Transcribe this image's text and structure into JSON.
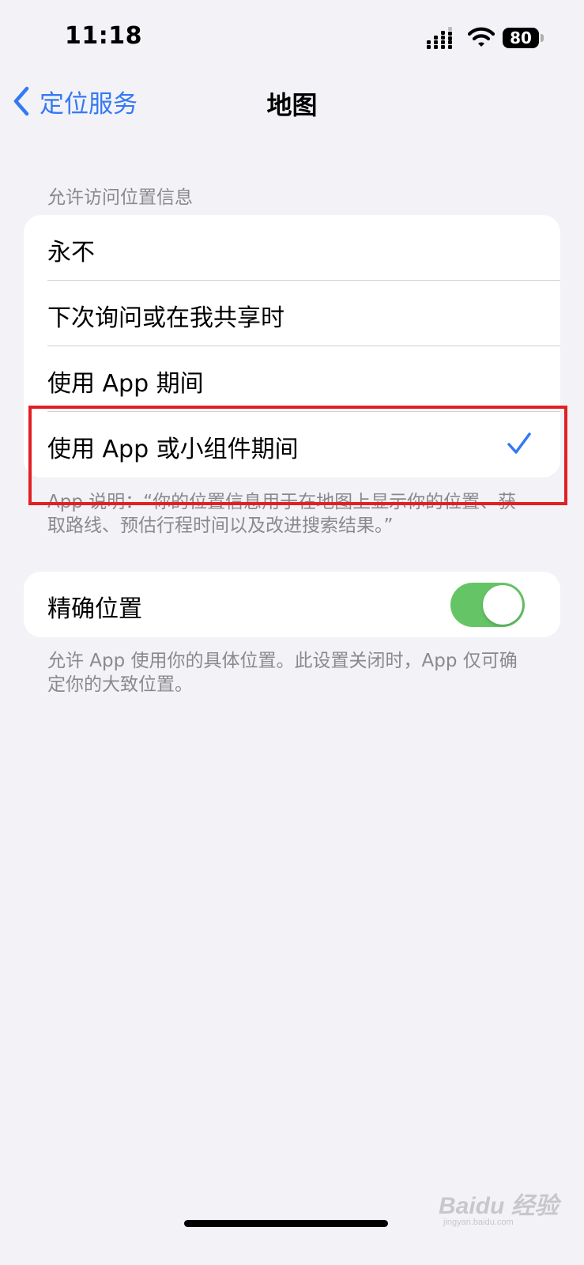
{
  "status_bar": {
    "time": "11:18",
    "battery_level": "80",
    "icons": [
      "signal-icon",
      "wifi-icon",
      "battery-icon"
    ]
  },
  "nav": {
    "back_label": "定位服务",
    "title": "地图",
    "accent_color": "#3478f6"
  },
  "location_access": {
    "header": "允许访问位置信息",
    "options": [
      {
        "label": "永不",
        "selected": false
      },
      {
        "label": "下次询问或在我共享时",
        "selected": false
      },
      {
        "label": "使用 App 期间",
        "selected": false
      },
      {
        "label": "使用 App 或小组件期间",
        "selected": true
      }
    ],
    "footer": "App 说明：“你的位置信息用于在地图上显示你的位置、获取路线、预估行程时间以及改进搜索结果。”"
  },
  "precise_location": {
    "label": "精确位置",
    "enabled": true,
    "toggle_color": "#65c466",
    "footer": "允许 App 使用你的具体位置。此设置关闭时，App 仅可确定你的大致位置。"
  },
  "highlight": {
    "color": "#e21f23"
  },
  "watermark": {
    "logo": "Baidu 经验",
    "sub": "jingyan.baidu.com"
  }
}
